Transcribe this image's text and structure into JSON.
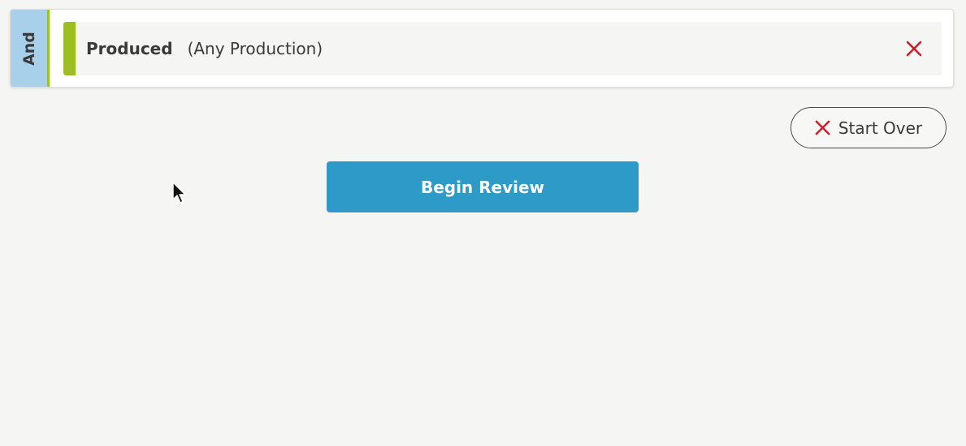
{
  "criteria": {
    "operator": "And",
    "items": [
      {
        "field": "Produced",
        "value": "(Any Production)"
      }
    ]
  },
  "actions": {
    "start_over_label": "Start Over",
    "begin_review_label": "Begin Review"
  },
  "icons": {
    "remove_criterion": "close-icon",
    "start_over": "close-icon",
    "pointer": "mouse-cursor-icon"
  },
  "colors": {
    "operator_tab": "#a9d0ea",
    "criterion_stripe": "#9fbe23",
    "remove_x": "#c8202a",
    "primary_button": "#2e9ac8"
  }
}
